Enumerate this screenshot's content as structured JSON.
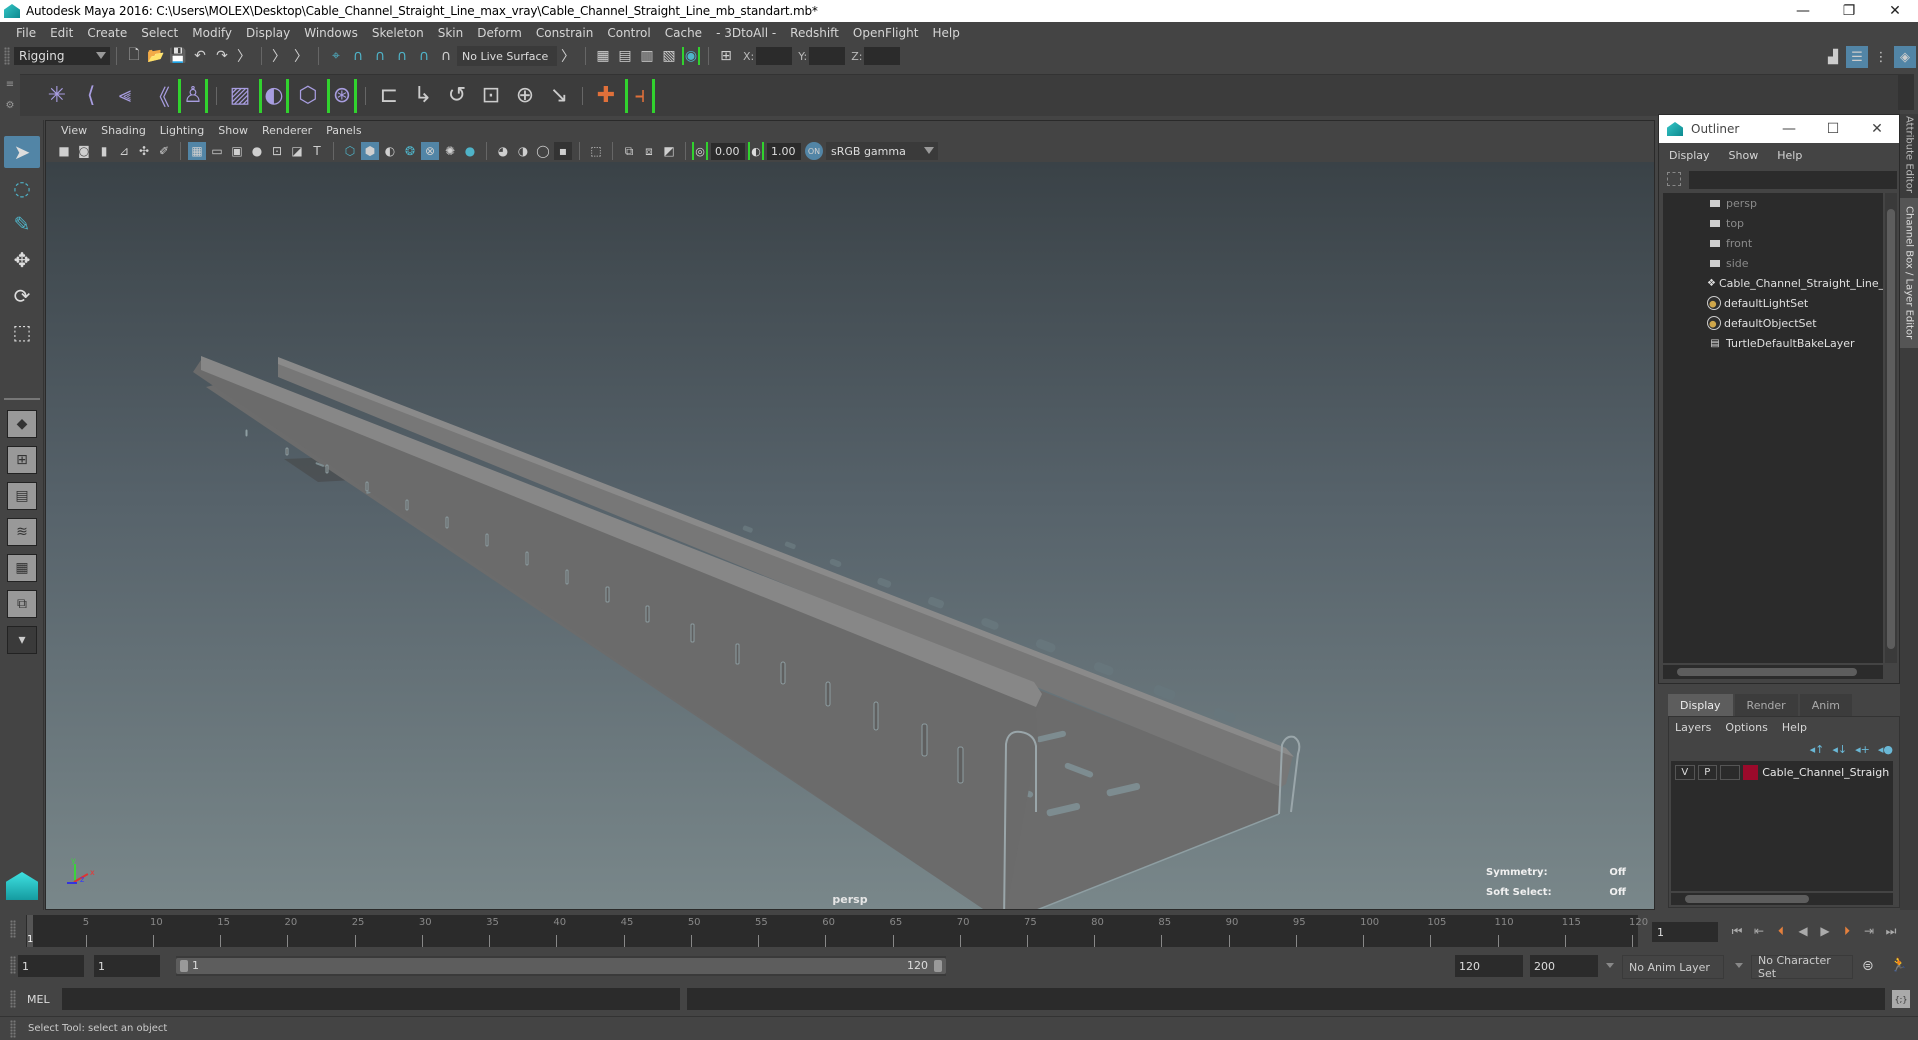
{
  "window": {
    "title": "Autodesk Maya 2016: C:\\Users\\MOLEX\\Desktop\\Cable_Channel_Straight_Line_max_vray\\Cable_Channel_Straight_Line_mb_standart.mb*",
    "controls": {
      "minimize": "—",
      "restore": "❐",
      "close": "✕"
    }
  },
  "menubar": [
    "File",
    "Edit",
    "Create",
    "Select",
    "Modify",
    "Display",
    "Windows",
    "Skeleton",
    "Skin",
    "Deform",
    "Constrain",
    "Control",
    "Cache",
    "- 3DtoAll -",
    "Redshift",
    "OpenFlight",
    "Help"
  ],
  "statusline": {
    "menu_set": "Rigging",
    "live_surface": "No Live Surface",
    "x_label": "X:",
    "y_label": "Y:",
    "z_label": "Z:",
    "x_value": "",
    "y_value": "",
    "z_value": ""
  },
  "shelf": {
    "icons": [
      "joint-tool-icon",
      "ik-handle-icon",
      "ik-spline-icon",
      "insert-joint-icon",
      "human-ik-icon",
      "paint-skin-weights-icon",
      "bind-skin-icon",
      "lattice-icon",
      "cluster-icon",
      "parent-constraint-icon",
      "point-constraint-icon",
      "orient-constraint-icon",
      "scale-constraint-icon",
      "aim-constraint-icon",
      "pole-vector-icon",
      "locator-icon",
      "set-driven-key-icon"
    ]
  },
  "viewport": {
    "menu": [
      "View",
      "Shading",
      "Lighting",
      "Show",
      "Renderer",
      "Panels"
    ],
    "exposure": "0.00",
    "gamma": "1.00",
    "color_space": "sRGB gamma",
    "camera": "persp",
    "hud": [
      {
        "label": "Symmetry:",
        "value": "Off"
      },
      {
        "label": "Soft Select:",
        "value": "Off"
      }
    ],
    "axis": {
      "x": "x",
      "y": "y",
      "z": "z"
    }
  },
  "outliner": {
    "title": "Outliner",
    "menu": [
      "Display",
      "Show",
      "Help"
    ],
    "search_value": "",
    "items": [
      {
        "label": "persp",
        "icon": "camera-icon",
        "dim": true
      },
      {
        "label": "top",
        "icon": "camera-icon",
        "dim": true
      },
      {
        "label": "front",
        "icon": "camera-icon",
        "dim": true
      },
      {
        "label": "side",
        "icon": "camera-icon",
        "dim": true
      },
      {
        "label": "Cable_Channel_Straight_Line_nc",
        "icon": "mesh-group-icon",
        "dim": false
      },
      {
        "label": "defaultLightSet",
        "icon": "set-icon",
        "dim": false
      },
      {
        "label": "defaultObjectSet",
        "icon": "set-icon",
        "dim": false
      },
      {
        "label": "TurtleDefaultBakeLayer",
        "icon": "bake-layer-icon",
        "dim": false
      }
    ]
  },
  "layer_editor": {
    "tabs": [
      "Display",
      "Render",
      "Anim"
    ],
    "active_tab": "Display",
    "menu": [
      "Layers",
      "Options",
      "Help"
    ],
    "layers": [
      {
        "visible": "V",
        "playback": "P",
        "type": "",
        "color": "#9b0a2b",
        "name": "Cable_Channel_Straight_L"
      }
    ]
  },
  "side_tabs": [
    "Attribute Editor",
    "Channel Box / Layer Editor"
  ],
  "timeline": {
    "ticks": [
      5,
      10,
      15,
      20,
      25,
      30,
      35,
      40,
      45,
      50,
      55,
      60,
      65,
      70,
      75,
      80,
      85,
      90,
      95,
      100,
      105,
      110,
      115,
      120
    ],
    "range": [
      1,
      120
    ],
    "current_frame": "1",
    "current_frame_field": "1"
  },
  "range": {
    "start": "1",
    "playback_start": "1",
    "slider_start": "1",
    "slider_end": "120",
    "playback_end": "120",
    "end": "200",
    "anim_layer": "No Anim Layer",
    "character_set": "No Character Set"
  },
  "mel": {
    "label": "MEL",
    "input": "",
    "output": ""
  },
  "help_line": "Select Tool: select an object"
}
